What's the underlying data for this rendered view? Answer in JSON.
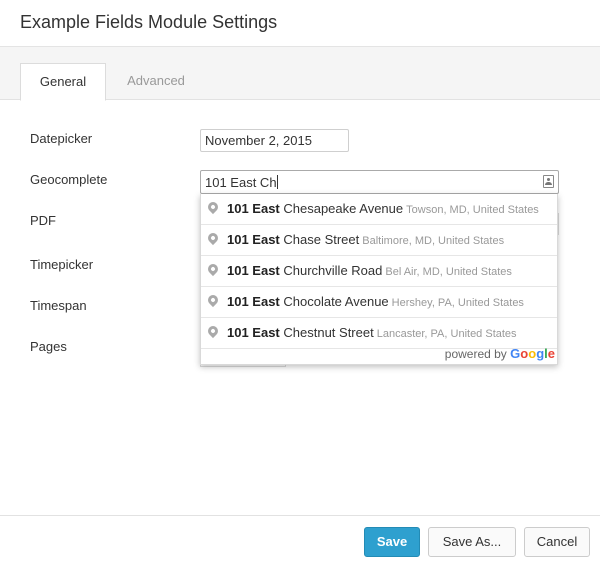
{
  "window": {
    "title": "Example Fields Module Settings"
  },
  "tabs": [
    {
      "label": "General",
      "active": true
    },
    {
      "label": "Advanced",
      "active": false
    }
  ],
  "fields": {
    "datepicker": {
      "label": "Datepicker",
      "value": "November 2, 2015"
    },
    "geocomplete": {
      "label": "Geocomplete",
      "value": "101 East Ch"
    },
    "pdf": {
      "label": "PDF"
    },
    "timepicker": {
      "label": "Timepicker"
    },
    "timespan": {
      "label": "Timespan"
    },
    "pages": {
      "label": "Pages"
    }
  },
  "suggestions": [
    {
      "match": "101 East",
      "rest": " Chesapeake Avenue",
      "secondary": "Towson, MD, United States"
    },
    {
      "match": "101 East",
      "rest": " Chase Street",
      "secondary": "Baltimore, MD, United States"
    },
    {
      "match": "101 East",
      "rest": " Churchville Road",
      "secondary": "Bel Air, MD, United States"
    },
    {
      "match": "101 East",
      "rest": " Chocolate Avenue",
      "secondary": "Hershey, PA, United States"
    },
    {
      "match": "101 East",
      "rest": " Chestnut Street",
      "secondary": "Lancaster, PA, United States"
    }
  ],
  "attribution": {
    "prefix": "powered by",
    "letters": [
      "G",
      "o",
      "o",
      "g",
      "l",
      "e"
    ],
    "colors": [
      "#4285F4",
      "#EA4335",
      "#FBBC05",
      "#4285F4",
      "#34A853",
      "#EA4335"
    ]
  },
  "buttons": {
    "save": "Save",
    "save_as": "Save As...",
    "cancel": "Cancel"
  },
  "colors": {
    "primary": "#2ea0cf",
    "tab_bar": "#f5f5f5"
  }
}
